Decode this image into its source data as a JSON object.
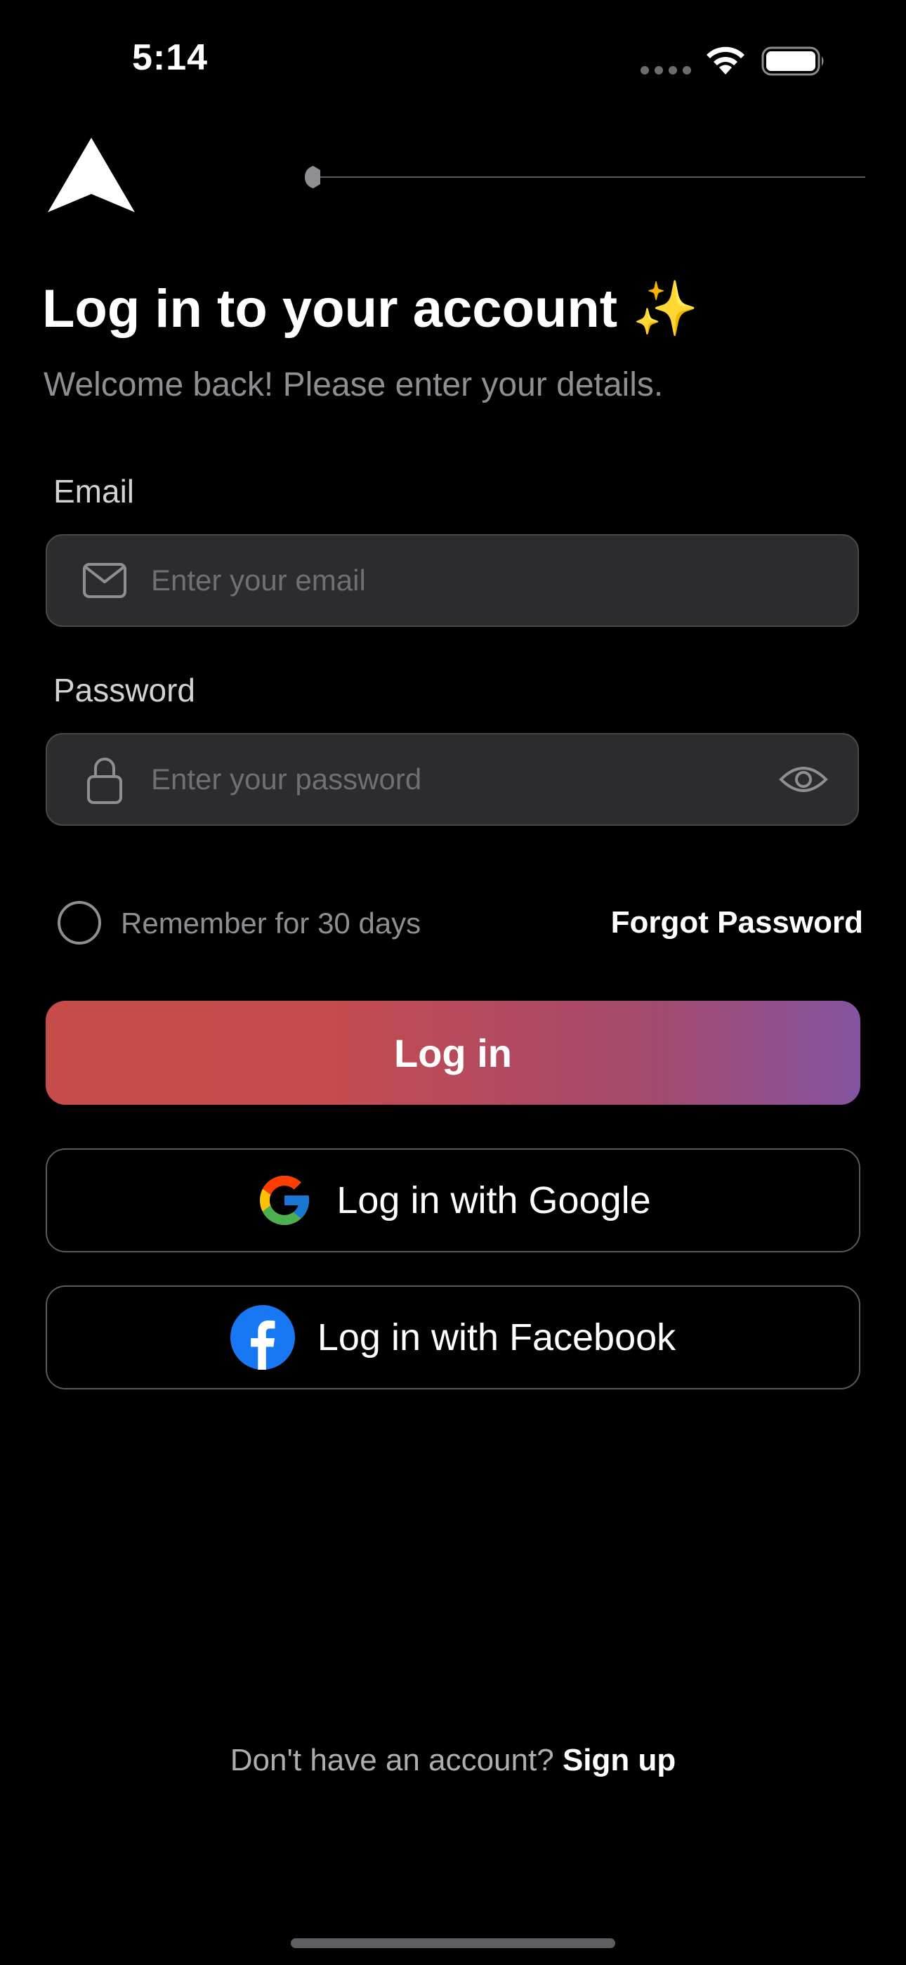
{
  "status_bar": {
    "time": "5:14"
  },
  "header": {
    "logo_icon": "arrow-logo-icon"
  },
  "title": {
    "text": "Log in to your account ✨",
    "subtitle": "Welcome back! Please enter your details."
  },
  "email": {
    "label": "Email",
    "placeholder": "Enter your email",
    "icon": "envelope-icon"
  },
  "password": {
    "label": "Password",
    "placeholder": "Enter your password",
    "icon": "lock-icon",
    "toggle_icon": "eye-icon"
  },
  "remember": {
    "label": "Remember for 30 days",
    "checked": false
  },
  "forgot": {
    "label": "Forgot Password"
  },
  "buttons": {
    "login": "Log in",
    "google": "Log in with Google",
    "facebook": "Log in with Facebook"
  },
  "footer": {
    "question": "Don't have an account?",
    "signup": "Sign up"
  },
  "colors": {
    "background": "#000000",
    "field_background": "#2c2c2e",
    "gradient_start": "#c54c4b",
    "gradient_end": "#8554a1",
    "facebook_blue": "#1877f2"
  }
}
